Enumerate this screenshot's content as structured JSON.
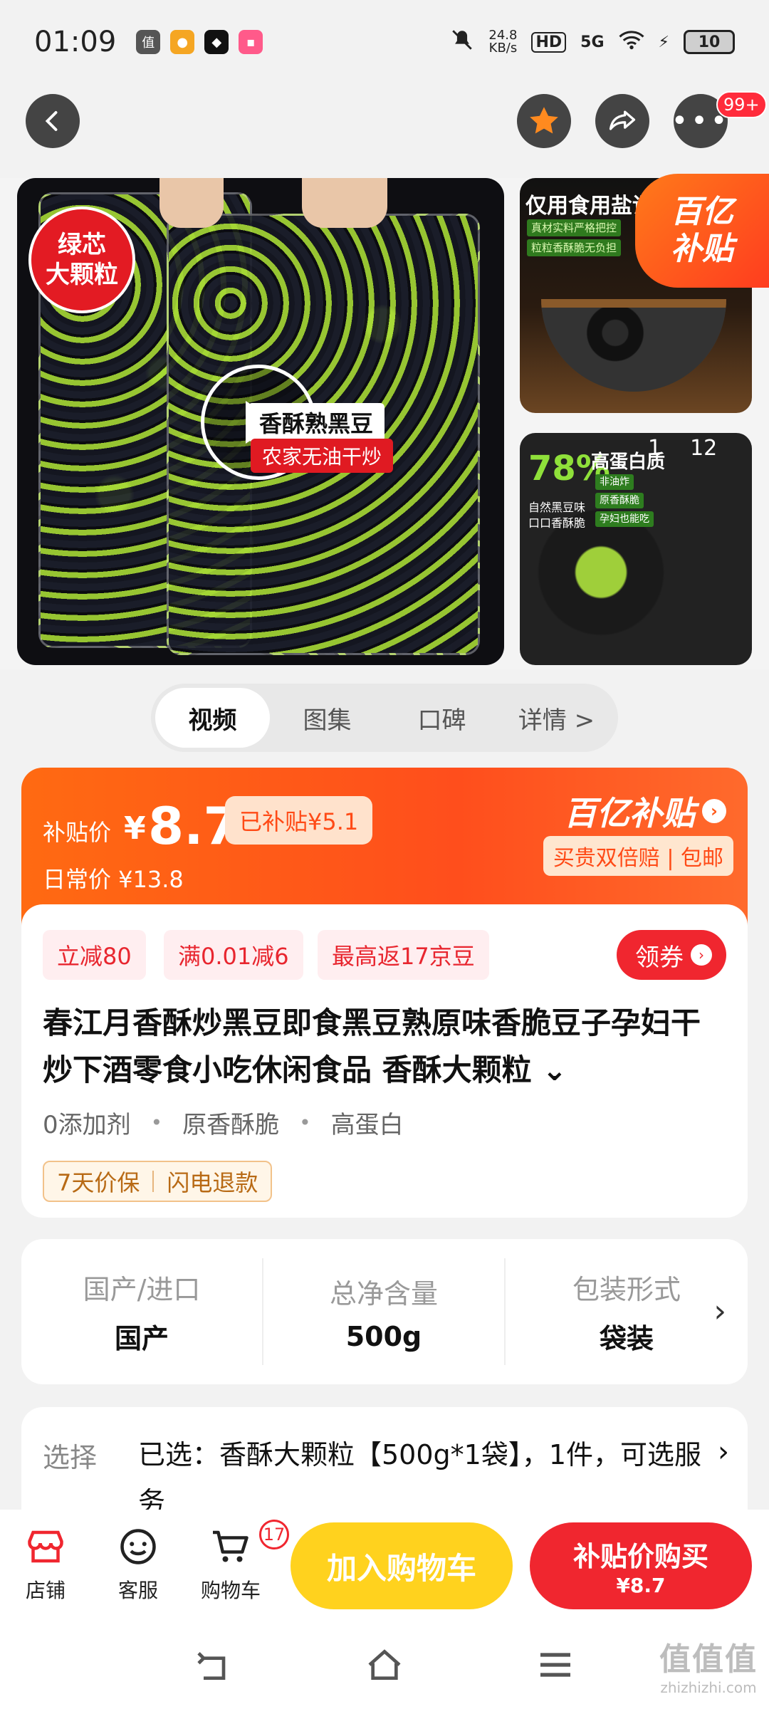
{
  "status_bar": {
    "time": "01:09",
    "speed_value": "24.8",
    "speed_unit": "KB/s",
    "network": "5G",
    "battery": "10",
    "app_icons": [
      "zhi-icon",
      "cat-icon",
      "penguin-icon",
      "lala-icon"
    ]
  },
  "header": {
    "more_badge": "99+"
  },
  "gallery": {
    "main_tag": [
      "绿芯",
      "大颗粒"
    ],
    "pack_label": "香酥熟黑豆",
    "pack_sub": "农家无油干炒",
    "side1_title": "仅用食用盐调",
    "side1_lines": [
      "真材实料严格把控",
      "粒粒香酥脆无负担"
    ],
    "side2_pct": "78%",
    "side2_title": "高蛋白质",
    "side2_chips": [
      "非油炸",
      "原香酥脆",
      "孕妇也能吃"
    ],
    "side2_left": [
      "自然黑豆味",
      "口口香酥脆"
    ],
    "counter_current": "1",
    "counter_total": "12",
    "subsidy_badge": [
      "百亿",
      "补贴"
    ]
  },
  "tabs": [
    "视频",
    "图集",
    "口碑",
    "详情 >"
  ],
  "price": {
    "label": "补贴价",
    "yen": "¥",
    "value": "8.7",
    "already_subsidized": "已补贴¥5.1",
    "daily": "日常价 ¥13.8",
    "brand": "百亿补贴",
    "guarantee": "买贵双倍赔 | 包邮"
  },
  "promo_chips": [
    "立减80",
    "满0.01减6",
    "最高返17京豆"
  ],
  "coupon_label": "领券",
  "product": {
    "title": "春江月香酥炒黑豆即食黑豆熟原味香脆豆子孕妇干炒下酒零食小吃休闲食品 香酥大颗粒 ⌄",
    "features": [
      "0添加剂",
      "原香酥脆",
      "高蛋白"
    ],
    "assurance": [
      "7天价保",
      "闪电退款"
    ]
  },
  "specs": [
    {
      "k": "国产/进口",
      "v": "国产"
    },
    {
      "k": "总净含量",
      "v": "500g"
    },
    {
      "k": "包装形式",
      "v": "袋装"
    }
  ],
  "selection": {
    "label": "选择",
    "value": "已选：香酥大颗粒【500g*1袋】，1件，可选服务"
  },
  "bottom": {
    "shop": "店铺",
    "service": "客服",
    "cart": "购物车",
    "cart_count": "17",
    "add_to_cart": "加入购物车",
    "buy_label": "补贴价购买",
    "buy_price": "¥8.7"
  },
  "watermark": {
    "logo": "值值值",
    "url": "zhizhizhi.com"
  },
  "colors": {
    "accent_orange": "#ff5a1a",
    "accent_red": "#f0262f",
    "accent_yellow": "#ffd21e"
  }
}
